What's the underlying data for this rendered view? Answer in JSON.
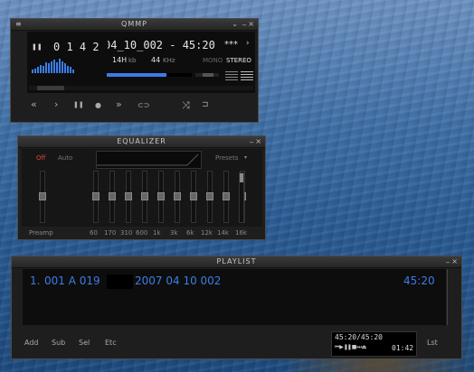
{
  "player": {
    "title": "QMMP",
    "menu_icon": "≡",
    "minimize": "_",
    "shade": "⌄",
    "close": "×",
    "pause_indicator": "❚❚",
    "time": "0 1 4 2",
    "track_title": "04_10_002 - 45:20",
    "stars": "***",
    "bitrate_value": "14H",
    "bitrate_unit": "kb",
    "sample_value": "44",
    "sample_unit": "KHz",
    "mono": "MONO",
    "stereo": "STEREO",
    "volume_level": 0.7,
    "balance_level": 0.55,
    "seek_level": 0.04,
    "controls": {
      "prev": "«",
      "play": "›",
      "pause": "❚❚",
      "stop": "●",
      "next": "»",
      "eject": "⊂⊃",
      "shuffle": "⤨",
      "repeat": "⊐"
    },
    "spectrum": [
      3,
      4,
      5,
      7,
      6,
      9,
      8,
      10,
      11,
      9,
      12,
      10,
      8,
      6,
      5,
      3
    ]
  },
  "equalizer": {
    "title": "EQUALIZER",
    "minimize": "_",
    "close": "×",
    "off_label": "Off",
    "auto_label": "Auto",
    "presets_label": "Presets",
    "preamp_label": "Preamp",
    "bands": [
      "60",
      "170",
      "310",
      "600",
      "1k",
      "3k",
      "6k",
      "12k",
      "14k",
      "16k"
    ],
    "band_levels": [
      0,
      0,
      0,
      0,
      0,
      0,
      0,
      0,
      0,
      0
    ],
    "preamp_level": 0,
    "volume_level": 1.0
  },
  "playlist": {
    "title": "PLAYLIST",
    "minimize": "_",
    "close": "×",
    "items": [
      {
        "number": "1.",
        "text_a": "001 A 019",
        "text_b": "2007 04 10 002",
        "duration": "45:20"
      }
    ],
    "buttons": {
      "add": "Add",
      "sub": "Sub",
      "sel": "Sel",
      "etc": "Etc",
      "lst": "Lst"
    },
    "time_display": "45:20/45:20",
    "elapsed": "01:42",
    "mini_controls": "⏮ ▶ ❚❚ ■ ⏭ ⏏"
  },
  "colors": {
    "accent_blue": "#3b7de8",
    "off_red": "#e04040",
    "text_light": "#e6e6e6"
  }
}
